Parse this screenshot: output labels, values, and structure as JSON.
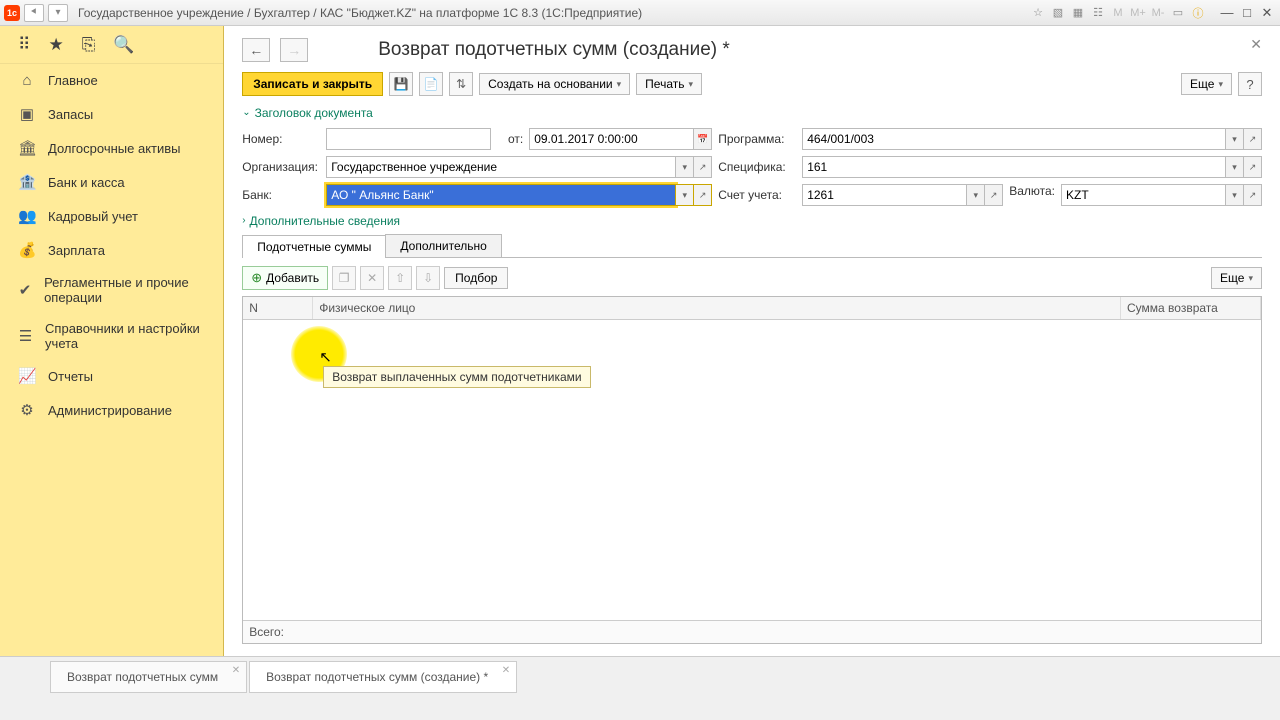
{
  "window": {
    "title": "Государственное учреждение / Бухгалтер / КАС \"Бюджет.KZ\" на платформе 1С 8.3  (1С:Предприятие)"
  },
  "sidebar": {
    "items": [
      {
        "label": "Главное"
      },
      {
        "label": "Запасы"
      },
      {
        "label": "Долгосрочные активы"
      },
      {
        "label": "Банк и касса"
      },
      {
        "label": "Кадровый учет"
      },
      {
        "label": "Зарплата"
      },
      {
        "label": "Регламентные и прочие операции"
      },
      {
        "label": "Справочники и настройки учета"
      },
      {
        "label": "Отчеты"
      },
      {
        "label": "Администрирование"
      }
    ]
  },
  "doc": {
    "title": "Возврат подотчетных сумм (создание) *",
    "save_close": "Записать и закрыть",
    "create_based": "Создать на основании",
    "print": "Печать",
    "more": "Еще",
    "header_collapse": "Заголовок документа",
    "extra_collapse": "Дополнительные сведения",
    "fields": {
      "number_lbl": "Номер:",
      "number_val": "",
      "date_lbl": "от:",
      "date_val": "09.01.2017 0:00:00",
      "program_lbl": "Программа:",
      "program_val": "464/001/003",
      "org_lbl": "Организация:",
      "org_val": "Государственное учреждение",
      "spec_lbl": "Специфика:",
      "spec_val": "161",
      "bank_lbl": "Банк:",
      "bank_val": "АО \" Альянс Банк\"",
      "account_lbl": "Счет учета:",
      "account_val": "1261",
      "currency_lbl": "Валюта:",
      "currency_val": "KZT"
    },
    "tabs": {
      "tab1": "Подотчетные суммы",
      "tab2": "Дополнительно"
    },
    "tabtoolbar": {
      "add": "Добавить",
      "select": "Подбор",
      "more": "Еще"
    },
    "grid": {
      "col_n": "N",
      "col_person": "Физическое лицо",
      "col_sum": "Сумма возврата",
      "total": "Всего:"
    },
    "tooltip": "Возврат выплаченных сумм подотчетниками"
  },
  "bottom_tabs": {
    "tab1": "Возврат подотчетных сумм",
    "tab2": "Возврат подотчетных сумм (создание) *"
  }
}
